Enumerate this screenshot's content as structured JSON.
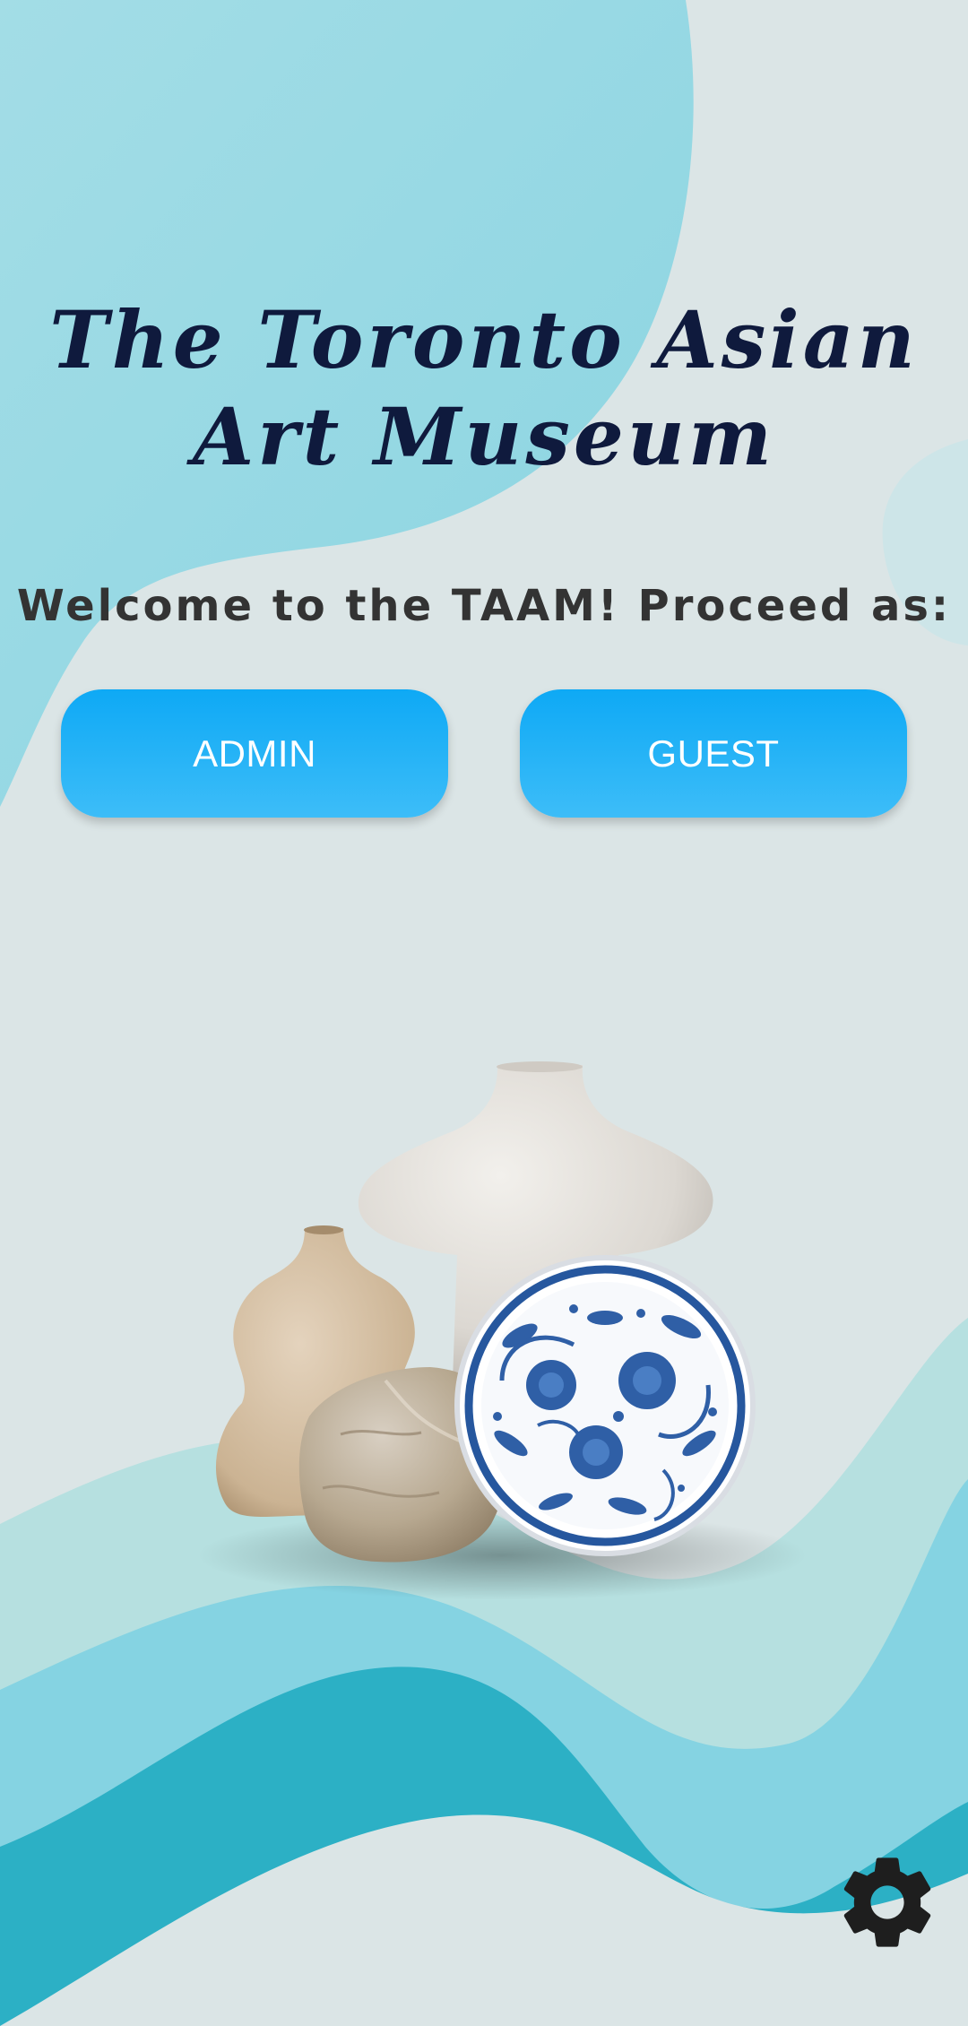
{
  "app": {
    "title_line1": "The Toronto Asian",
    "title_line2": "Art Museum",
    "welcome": "Welcome to the TAAM! Proceed as:"
  },
  "buttons": {
    "admin_label": "ADMIN",
    "guest_label": "GUEST"
  },
  "icons": {
    "settings": "gear-icon"
  },
  "colors": {
    "background": "#dbe5e6",
    "blob": "#8fd6e2",
    "button": "#1fb0f6",
    "title": "#0f1a3d",
    "subtitle": "#333333",
    "wave_light": "#b6e0e0",
    "wave_mid": "#85d3e2",
    "wave_dark": "#2cb0c5"
  }
}
